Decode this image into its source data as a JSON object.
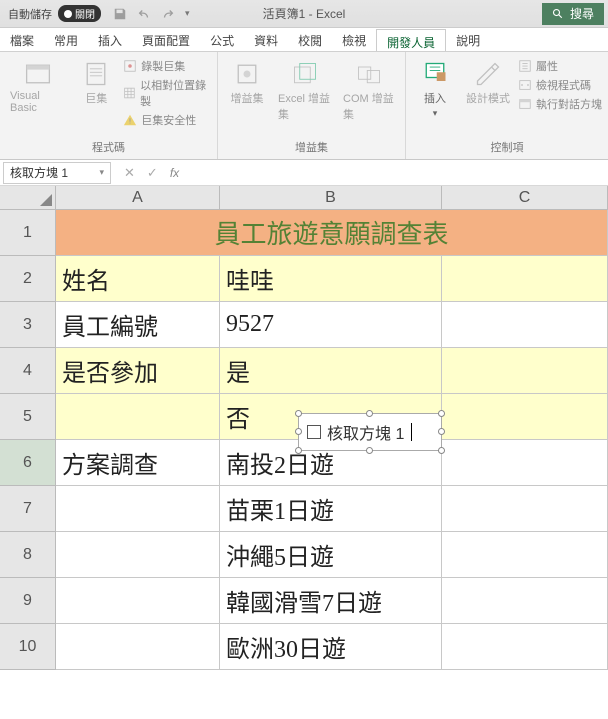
{
  "title": {
    "autosave_label": "自動儲存",
    "autosave_state": "關閉",
    "doc": "活頁簿1 - Excel",
    "search": "搜尋"
  },
  "menu": {
    "items": [
      "檔案",
      "常用",
      "插入",
      "頁面配置",
      "公式",
      "資料",
      "校閱",
      "檢視",
      "開發人員",
      "說明"
    ],
    "active": 8
  },
  "ribbon": {
    "code": {
      "vb": "Visual Basic",
      "macros": "巨集",
      "rec": "錄製巨集",
      "rel": "以相對位置錄製",
      "sec": "巨集安全性",
      "label": "程式碼"
    },
    "addins": {
      "a1": "增益集",
      "a2": "Excel 增益集",
      "a3": "COM 增益集",
      "label": "增益集"
    },
    "controls": {
      "insert": "插入",
      "design": "設計模式",
      "prop": "屬性",
      "view": "檢視程式碼",
      "run": "執行對話方塊",
      "label": "控制項"
    }
  },
  "namebox": "核取方塊 1",
  "cols": [
    "A",
    "B",
    "C"
  ],
  "rows": [
    "1",
    "2",
    "3",
    "4",
    "5",
    "6",
    "7",
    "8",
    "9",
    "10"
  ],
  "cells": {
    "title": "員工旅遊意願調查表",
    "a2": "姓名",
    "b2": "哇哇",
    "a3": "員工編號",
    "b3": "9527",
    "a4": "是否參加",
    "b4": "是",
    "b5": "否",
    "a6": "方案調查",
    "b6": "南投2日遊",
    "b7": "苗栗1日遊",
    "b8": "沖繩5日遊",
    "b9": "韓國滑雪7日遊",
    "b10": "歐洲30日遊"
  },
  "checkbox": {
    "label": "核取方塊 1"
  }
}
